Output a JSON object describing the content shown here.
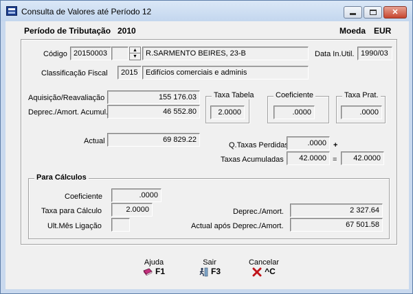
{
  "window": {
    "title": "Consulta de Valores até Período 12"
  },
  "header": {
    "period_label": "Período de Tributação",
    "period_value": "2010",
    "currency_label": "Moeda",
    "currency_value": "EUR"
  },
  "asset": {
    "code_label": "Código",
    "code_value": "20150003",
    "code_extra": "",
    "description": "R.SARMENTO BEIRES, 23-B",
    "date_label": "Data In.Util.",
    "date_value": "1990/03",
    "classification_label": "Classificação Fiscal",
    "classification_code": "2015",
    "classification_desc": "Edifícios comerciais e adminis"
  },
  "values": {
    "acquisition_label": "Aquisição/Reavaliação",
    "acquisition_value": "155 176.03",
    "accumulated_label": "Deprec./Amort. Acumul.",
    "accumulated_value": "46 552.80",
    "actual_label": "Actual",
    "actual_value": "69 829.22"
  },
  "rates": {
    "tabela_label": "Taxa Tabela",
    "tabela_value": "2.0000",
    "coef_label": "Coeficiente",
    "coef_value": ".0000",
    "prat_label": "Taxa Prat.",
    "prat_value": ".0000",
    "lost_label": "Q.Taxas Perdidas",
    "lost_value": ".0000",
    "plus": "+",
    "accum_label": "Taxas Acumuladas",
    "accum_value": "42.0000",
    "equals": "=",
    "accum_total": "42.0000"
  },
  "calc": {
    "title": "Para Cálculos",
    "coef_label": "Coeficiente",
    "coef_value": ".0000",
    "rate_label": "Taxa para Cálculo",
    "rate_value": "2.0000",
    "lastmonth_label": "Ult.Mês Ligação",
    "lastmonth_value": "",
    "deprec_label": "Deprec./Amort.",
    "deprec_value": "2 327.64",
    "after_label": "Actual após Deprec./Amort.",
    "after_value": "67 501.58"
  },
  "footer": {
    "help_label": "Ajuda",
    "help_key": "F1",
    "help_icon": "book-icon",
    "exit_label": "Sair",
    "exit_key": "F3",
    "exit_icon": "running-man-icon",
    "cancel_label": "Cancelar",
    "cancel_key": "^C",
    "cancel_icon": "red-x-icon"
  }
}
